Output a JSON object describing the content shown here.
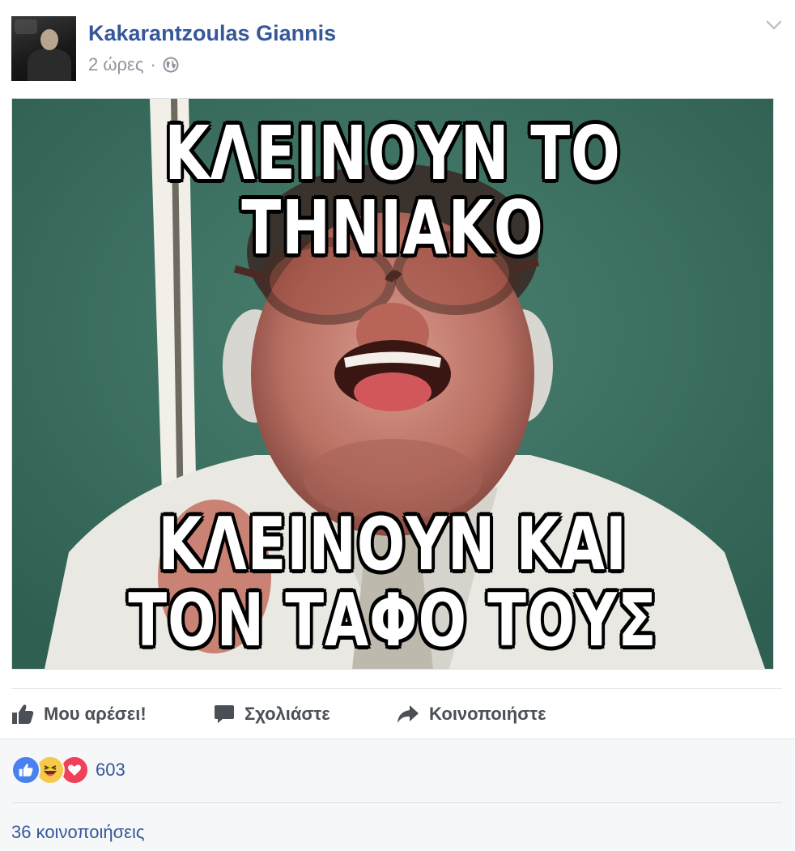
{
  "post": {
    "author": "Kakarantzoulas Giannis",
    "timestamp": "2 ώρες",
    "separator": "·",
    "privacy_icon": "globe-icon",
    "menu_icon": "chevron-down-icon"
  },
  "image": {
    "top_text": "ΚΛΕΙΝΟΥΝ ΤΟ ΤΗΝΙΑΚΟ",
    "bottom_text_line1": "ΚΛΕΙΝΟΥΝ ΚΑΙ",
    "bottom_text_line2": "ΤΟΝ ΤΑΦΟ ΤΟΥΣ"
  },
  "actions": {
    "like_label": "Μου αρέσει!",
    "comment_label": "Σχολιάστε",
    "share_label": "Κοινοποιήστε"
  },
  "reactions": {
    "icons": [
      "like-reaction-icon",
      "haha-reaction-icon",
      "love-reaction-icon"
    ],
    "count": "603"
  },
  "shares": {
    "label": "36 κοινοποιήσεις"
  },
  "colors": {
    "link_blue": "#365899",
    "meta_gray": "#90949c",
    "action_gray": "#4b4f56",
    "footer_bg": "#f6f7f9"
  }
}
